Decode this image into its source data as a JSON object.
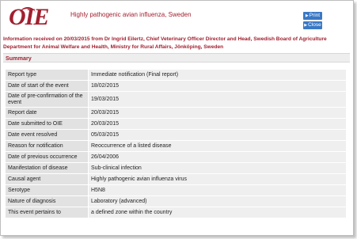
{
  "header": {
    "logo_text": "OIE",
    "title": "Highly pathogenic avian influenza, Sweden",
    "print_label": "Print",
    "close_label": "Close"
  },
  "info": "Information received on 20/03/2015 from Dr Ingrid Eilertz, Chief Veterinary Officer Director and Head, Swedish Board of Agriculture Department for Animal Welfare and Health, Ministry for Rural Affairs, Jönköping, Sweden",
  "summary": {
    "heading": "Summary",
    "rows": [
      {
        "key": "Report type",
        "value": "Immediate notification (Final report)"
      },
      {
        "key": "Date of start of the event",
        "value": "18/02/2015"
      },
      {
        "key": "Date of pre-confirmation of the event",
        "value": "19/03/2015"
      },
      {
        "key": "Report date",
        "value": "20/03/2015"
      },
      {
        "key": "Date submitted to OIE",
        "value": "20/03/2015"
      },
      {
        "key": "Date event resolved",
        "value": "05/03/2015"
      },
      {
        "key": "Reason for notification",
        "value": "Reoccurrence of a listed disease"
      },
      {
        "key": "Date of previous occurrence",
        "value": "26/04/2006"
      },
      {
        "key": "Manifestation of disease",
        "value": "Sub-clinical infection"
      },
      {
        "key": "Causal agent",
        "value": "Highly pathogenic avian influenza virus"
      },
      {
        "key": "Serotype",
        "value": "H5N8"
      },
      {
        "key": "Nature of diagnosis",
        "value": "Laboratory (advanced)"
      },
      {
        "key": "This event pertains to",
        "value": "a defined zone within the country"
      }
    ]
  }
}
